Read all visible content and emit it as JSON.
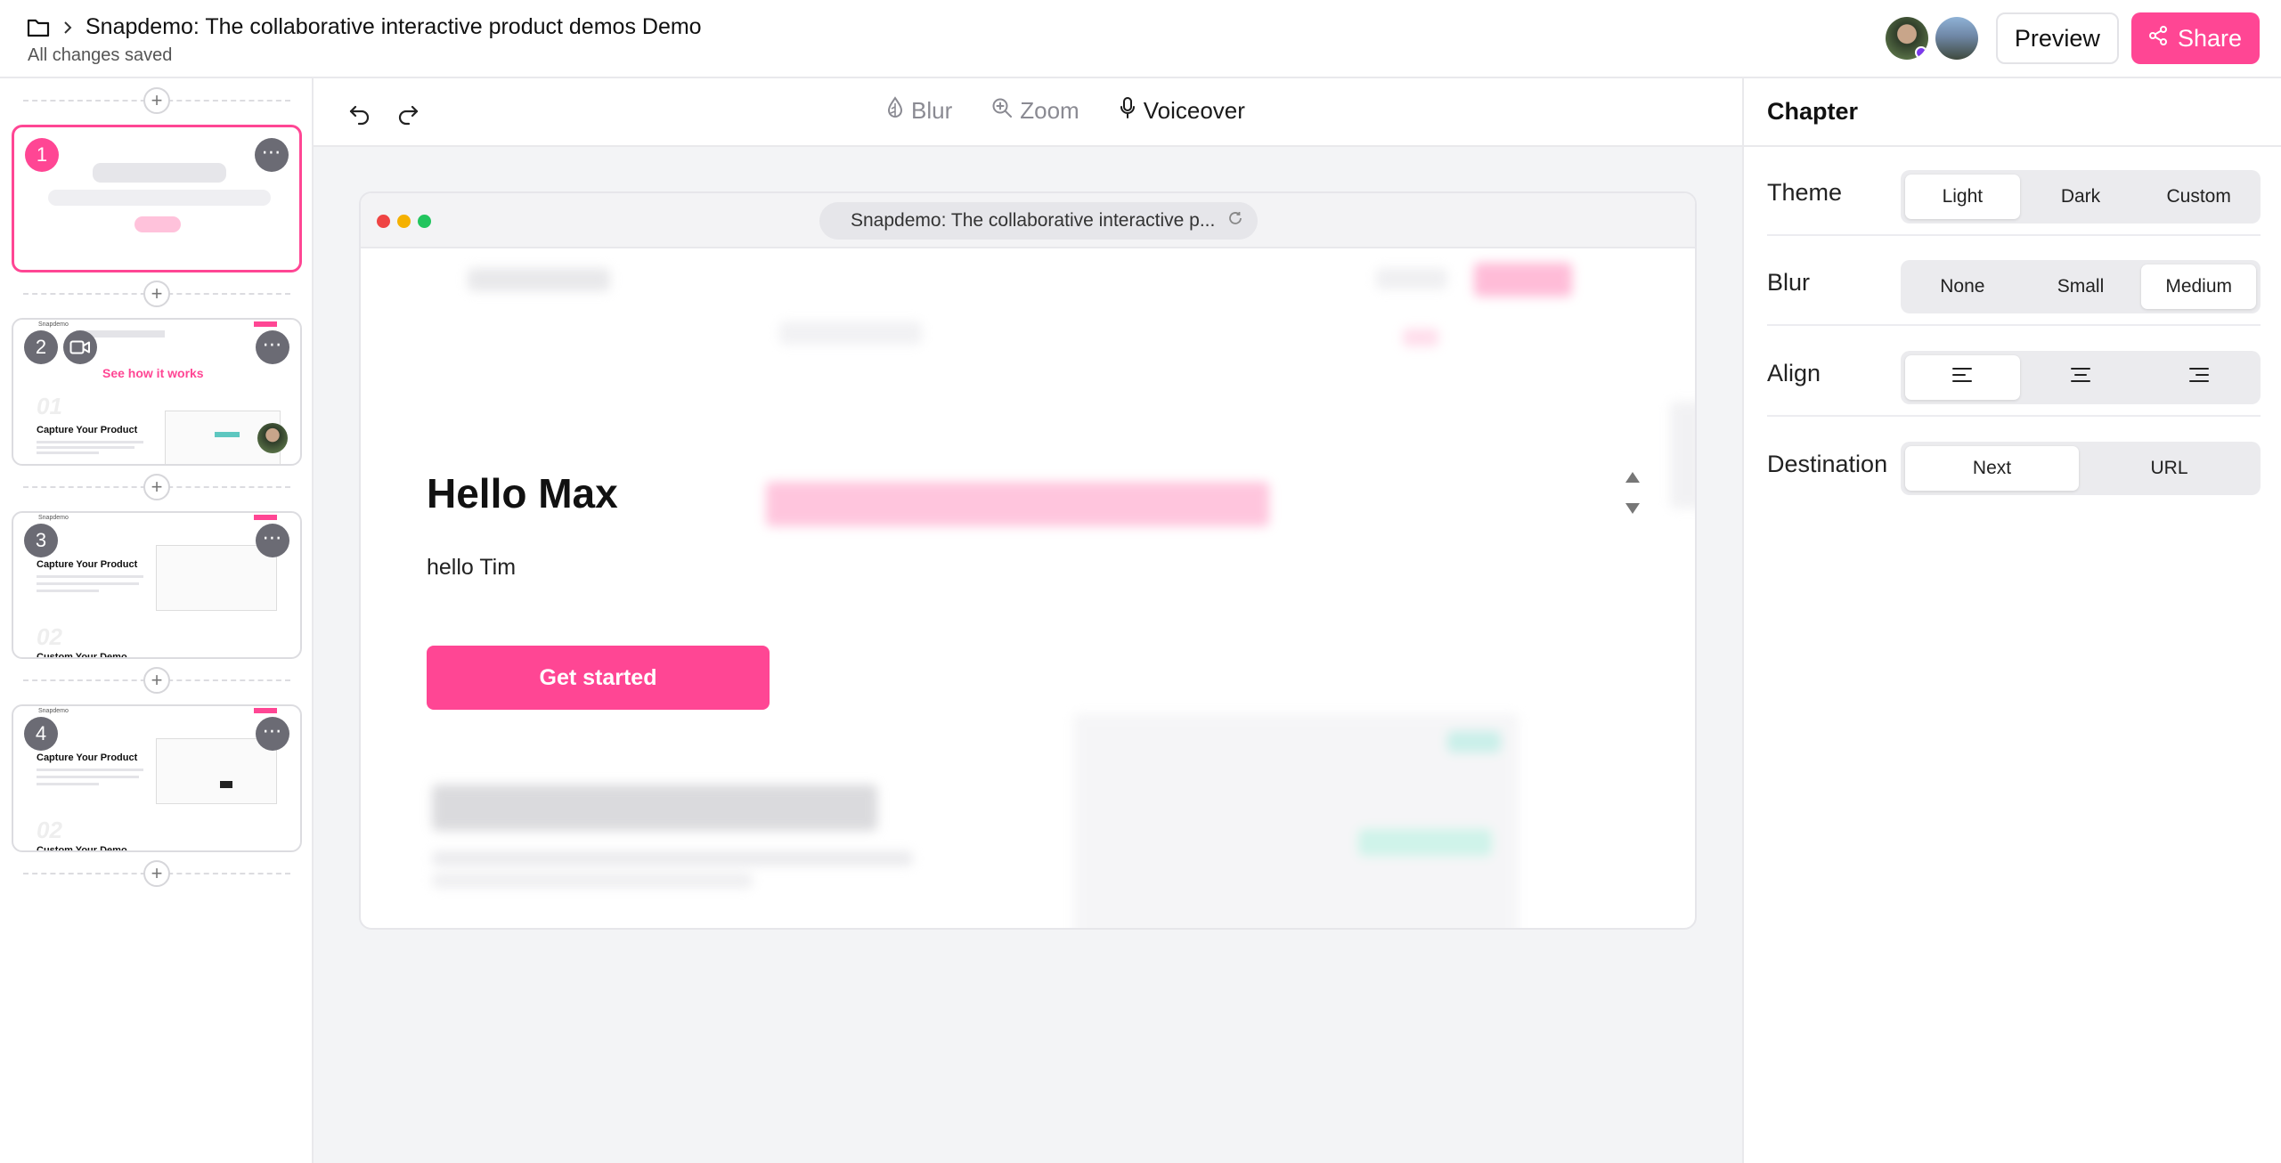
{
  "header": {
    "title": "Snapdemo: The collaborative interactive product demos Demo",
    "status": "All changes saved",
    "preview_label": "Preview",
    "share_label": "Share"
  },
  "sidebar": {
    "slides": [
      {
        "number": "1",
        "type": "chapter"
      },
      {
        "number": "2",
        "brand": "Snapdemo",
        "heading": "See how it works",
        "subheading": "Capture Your Product"
      },
      {
        "number": "3",
        "brand": "Snapdemo",
        "heading": "Capture Your Product",
        "subheading": "Custom Your Demo"
      },
      {
        "number": "4",
        "brand": "Snapdemo",
        "heading": "Capture Your Product",
        "subheading": "Custom Your Demo"
      }
    ]
  },
  "toolbar": {
    "tools": [
      {
        "label": "Blur",
        "icon": "droplet-icon"
      },
      {
        "label": "Zoom",
        "icon": "zoom-in-icon"
      },
      {
        "label": "Voiceover",
        "icon": "microphone-icon"
      }
    ]
  },
  "canvas": {
    "url": "Snapdemo: The collaborative interactive p...",
    "heading": "Hello Max",
    "text": "hello Tim",
    "cta_label": "Get started"
  },
  "panel": {
    "title": "Chapter",
    "theme": {
      "label": "Theme",
      "options": [
        "Light",
        "Dark",
        "Custom"
      ],
      "selected": "Light"
    },
    "blur": {
      "label": "Blur",
      "options": [
        "None",
        "Small",
        "Medium"
      ],
      "selected": "Medium"
    },
    "align": {
      "label": "Align",
      "options": [
        "align-left-icon",
        "align-center-icon",
        "align-right-icon"
      ],
      "selected": "align-left-icon"
    },
    "destination": {
      "label": "Destination",
      "options": [
        "Next",
        "URL"
      ],
      "selected": "Next"
    }
  },
  "colors": {
    "accent": "#ff4694",
    "avatar_status": "#7c3aed"
  }
}
